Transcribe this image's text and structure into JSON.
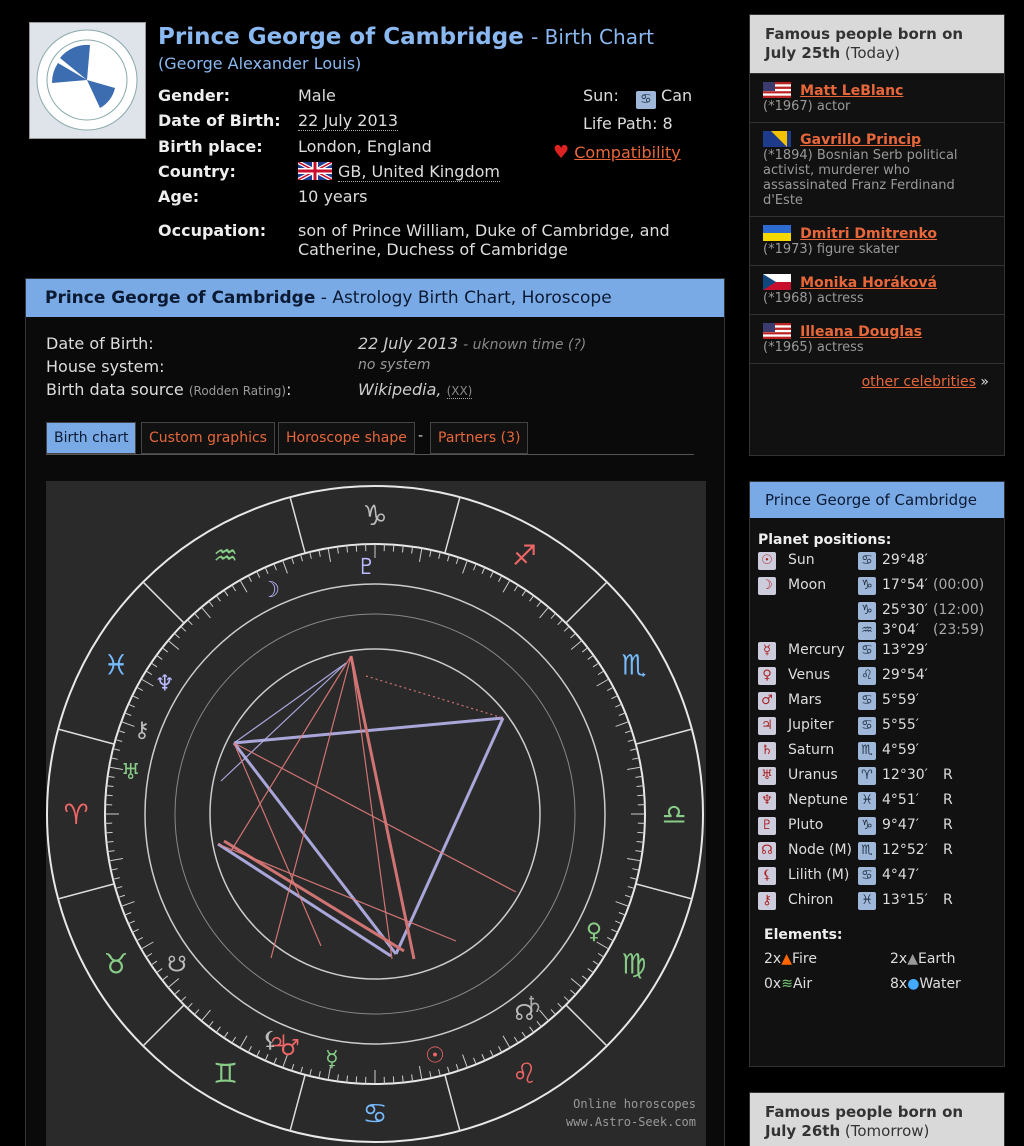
{
  "header": {
    "name": "Prince George of Cambridge",
    "title_suffix": "- Birth Chart",
    "alias": "(George Alexander Louis)",
    "fields": [
      {
        "key": "Gender",
        "value": "Male"
      },
      {
        "key": "Date of Birth",
        "value": "22 July 2013"
      },
      {
        "key": "Birth place",
        "value": "London, England"
      },
      {
        "key": "Country",
        "value": "GB, United Kingdom"
      },
      {
        "key": "Age",
        "value": "10 years"
      },
      {
        "key": "Occupation",
        "value": "son of Prince William, Duke of Cambridge, and Catherine, Duchess of Cambridge"
      }
    ],
    "sun_label": "Sun:",
    "sun_value": "Can",
    "life_path": "Life Path: 8",
    "compatibility": "Compatibility"
  },
  "panel": {
    "title_name": "Prince George of Cambridge",
    "title_rest": "- Astrology Birth Chart, Horoscope",
    "dob_label": "Date of Birth:",
    "dob_value": "22 July 2013",
    "dob_time": "- uknown time (?)",
    "house_label": "House system:",
    "house_value": "no system",
    "source_label": "Birth data source",
    "source_rating": "(Rodden Rating)",
    "source_colon": ":",
    "source_value": "Wikipedia,",
    "source_xx": "(XX)",
    "tabs": [
      "Birth chart",
      "Custom graphics",
      "Horoscope shape",
      "Partners (3)"
    ],
    "tab_sep": "-",
    "watermark_1": "Online horoscopes",
    "watermark_2": "www.Astro-Seek.com"
  },
  "famous_today": {
    "head_1": "Famous people born on",
    "head_date": "July 25th",
    "head_when": "(Today)",
    "people": [
      {
        "name": "Matt LeBlanc",
        "desc": "(*1967) actor"
      },
      {
        "name": "Gavrillo Princip",
        "desc": "(*1894) Bosnian Serb political activist, murderer who assassinated Franz Ferdinand d'Este"
      },
      {
        "name": "Dmitri Dmitrenko",
        "desc": "(*1973) figure skater"
      },
      {
        "name": "Monika Horáková",
        "desc": "(*1968) actress"
      },
      {
        "name": "Illeana Douglas",
        "desc": "(*1965) actress"
      }
    ],
    "more": "other celebrities",
    "more_arrow": "»"
  },
  "positions": {
    "head": "Prince George of Cambridge",
    "title": "Planet positions:",
    "planets": [
      {
        "name": "Sun",
        "sign": "♋",
        "deg": "29°48′",
        "time": "",
        "r": ""
      },
      {
        "name": "Moon",
        "sign": "♑",
        "deg": "17°54′",
        "time": "(00:00)",
        "r": ""
      },
      {
        "name": "",
        "sign": "♑",
        "deg": "25°30′",
        "time": "(12:00)",
        "r": ""
      },
      {
        "name": "",
        "sign": "♒",
        "deg": "3°04′",
        "time": "(23:59)",
        "r": ""
      },
      {
        "name": "Mercury",
        "sign": "♋",
        "deg": "13°29′",
        "time": "",
        "r": ""
      },
      {
        "name": "Venus",
        "sign": "♌",
        "deg": "29°54′",
        "time": "",
        "r": ""
      },
      {
        "name": "Mars",
        "sign": "♋",
        "deg": "5°59′",
        "time": "",
        "r": ""
      },
      {
        "name": "Jupiter",
        "sign": "♋",
        "deg": "5°55′",
        "time": "",
        "r": ""
      },
      {
        "name": "Saturn",
        "sign": "♏",
        "deg": "4°59′",
        "time": "",
        "r": ""
      },
      {
        "name": "Uranus",
        "sign": "♈",
        "deg": "12°30′",
        "time": "",
        "r": "R"
      },
      {
        "name": "Neptune",
        "sign": "♓",
        "deg": "4°51′",
        "time": "",
        "r": "R"
      },
      {
        "name": "Pluto",
        "sign": "♑",
        "deg": "9°47′",
        "time": "",
        "r": "R"
      },
      {
        "name": "Node (M)",
        "sign": "♏",
        "deg": "12°52′",
        "time": "",
        "r": "R"
      },
      {
        "name": "Lilith (M)",
        "sign": "♋",
        "deg": "4°47′",
        "time": "",
        "r": ""
      },
      {
        "name": "Chiron",
        "sign": "♓",
        "deg": "13°15′",
        "time": "",
        "r": "R"
      }
    ],
    "elements_title": "Elements:",
    "elements": [
      {
        "count": "2x",
        "name": "Fire"
      },
      {
        "count": "2x",
        "name": "Earth"
      },
      {
        "count": "0x",
        "name": "Air"
      },
      {
        "count": "8x",
        "name": "Water"
      }
    ]
  },
  "famous_tomorrow": {
    "head_1": "Famous people born on",
    "head_date": "July 26th",
    "head_when": "(Tomorrow)"
  },
  "colors": {
    "accent_blue": "#7aaae6",
    "link_orange": "#e8673a"
  }
}
